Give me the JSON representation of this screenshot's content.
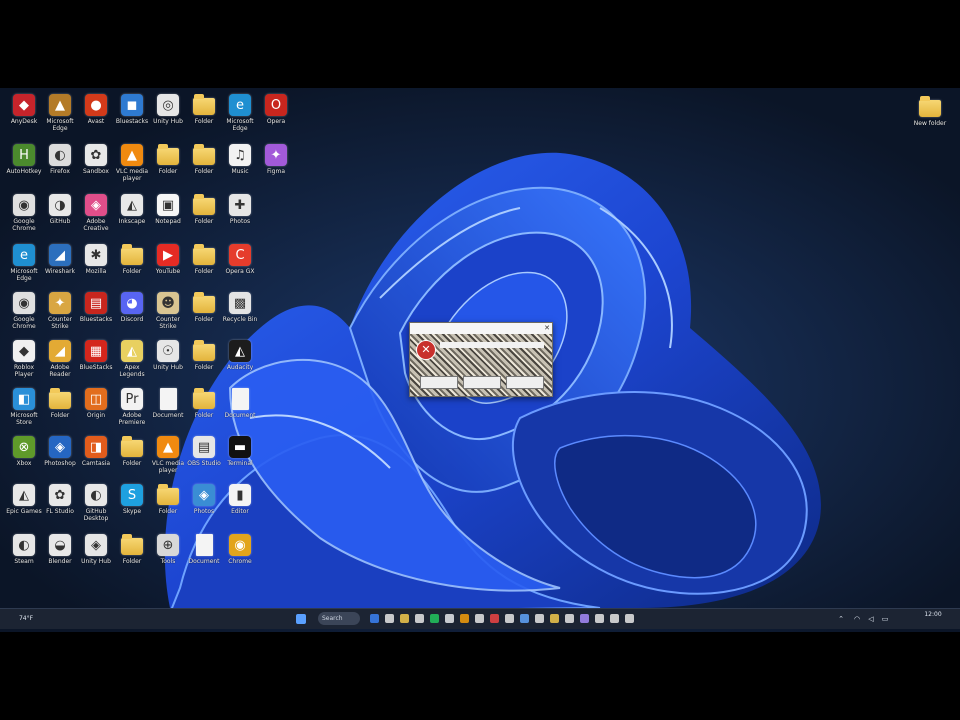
{
  "desktop": {
    "icons": [
      {
        "label": "AnyDesk",
        "glyph": "app",
        "color": "#c6242b",
        "sym": "◆"
      },
      {
        "label": "Microsoft Edge",
        "glyph": "app",
        "color": "#b47b28",
        "sym": "▲"
      },
      {
        "label": "Avast",
        "glyph": "app",
        "color": "#d33a1a",
        "sym": "●"
      },
      {
        "label": "Bluestacks",
        "glyph": "app",
        "color": "#2e7ad1",
        "sym": "◼"
      },
      {
        "label": "Unity Hub",
        "glyph": "app",
        "color": "#e6e6e6",
        "sym": "◎"
      },
      {
        "label": "Folder",
        "glyph": "folder"
      },
      {
        "label": "Microsoft Edge",
        "glyph": "app",
        "color": "#1f8fd1",
        "sym": "e"
      },
      {
        "label": "Opera",
        "glyph": "app",
        "color": "#c8261e",
        "sym": "O"
      },
      {
        "label": "AutoHotkey",
        "glyph": "app",
        "color": "#4b8a2d",
        "sym": "H"
      },
      {
        "label": "Firefox",
        "glyph": "app",
        "color": "#dcdcdc",
        "sym": "◐"
      },
      {
        "label": "Sandbox",
        "glyph": "app",
        "color": "#e8e8e8",
        "sym": "✿"
      },
      {
        "label": "VLC media player",
        "glyph": "app",
        "color": "#f08a10",
        "sym": "▲"
      },
      {
        "label": "Folder",
        "glyph": "folder"
      },
      {
        "label": "Folder",
        "glyph": "folder"
      },
      {
        "label": "Music",
        "glyph": "app",
        "color": "#f2f2f2",
        "sym": "♫"
      },
      {
        "label": "Figma",
        "glyph": "app",
        "color": "#a25ad9",
        "sym": "✦"
      },
      {
        "label": "Google Chrome",
        "glyph": "app",
        "color": "#e0e0e0",
        "sym": "◉"
      },
      {
        "label": "GitHub",
        "glyph": "app",
        "color": "#e8e8e8",
        "sym": "◑"
      },
      {
        "label": "Adobe Creative",
        "glyph": "app",
        "color": "#e04e8a",
        "sym": "◈"
      },
      {
        "label": "Inkscape",
        "glyph": "app",
        "color": "#e8e8e8",
        "sym": "◭"
      },
      {
        "label": "Notepad",
        "glyph": "app",
        "color": "#f6f6f6",
        "sym": "▣"
      },
      {
        "label": "Folder",
        "glyph": "folder"
      },
      {
        "label": "Photos",
        "glyph": "app",
        "color": "#e6e6e6",
        "sym": "✚"
      },
      {
        "label": "Microsoft Edge",
        "glyph": "app",
        "color": "#1f8fd1",
        "sym": "e"
      },
      {
        "label": "Wireshark",
        "glyph": "app",
        "color": "#2c6fbd",
        "sym": "◢"
      },
      {
        "label": "Mozilla",
        "glyph": "app",
        "color": "#e7e7e7",
        "sym": "✱"
      },
      {
        "label": "Folder",
        "glyph": "folder"
      },
      {
        "label": "YouTube",
        "glyph": "app",
        "color": "#e52b24",
        "sym": "▶"
      },
      {
        "label": "Folder",
        "glyph": "folder"
      },
      {
        "label": "Opera GX",
        "glyph": "app",
        "color": "#e53c2c",
        "sym": "C"
      },
      {
        "label": "Google Chrome",
        "glyph": "app",
        "color": "#e0e0e0",
        "sym": "◉"
      },
      {
        "label": "Counter Strike",
        "glyph": "app",
        "color": "#d9a642",
        "sym": "✦"
      },
      {
        "label": "Bluestacks",
        "glyph": "app",
        "color": "#c8261e",
        "sym": "▤"
      },
      {
        "label": "Discord",
        "glyph": "app",
        "color": "#5865f2",
        "sym": "◕"
      },
      {
        "label": "Counter Strike",
        "glyph": "app",
        "color": "#d9c592",
        "sym": "☻"
      },
      {
        "label": "Folder",
        "glyph": "folder"
      },
      {
        "label": "Recycle Bin",
        "glyph": "app",
        "color": "#e4e4e4",
        "sym": "▩"
      },
      {
        "label": "Roblox Player",
        "glyph": "app",
        "color": "#f0f0f0",
        "sym": "◆"
      },
      {
        "label": "Adobe Reader",
        "glyph": "app",
        "color": "#e3aa34",
        "sym": "◢"
      },
      {
        "label": "BlueStacks",
        "glyph": "app",
        "color": "#d4261c",
        "sym": "▦"
      },
      {
        "label": "Apex Legends",
        "glyph": "app",
        "color": "#e8d060",
        "sym": "◭"
      },
      {
        "label": "Unity Hub",
        "glyph": "app",
        "color": "#e6e6e6",
        "sym": "☉"
      },
      {
        "label": "Folder",
        "glyph": "folder"
      },
      {
        "label": "Audacity",
        "glyph": "app",
        "color": "#1c1c1c",
        "sym": "◭"
      },
      {
        "label": "Microsoft Store",
        "glyph": "app",
        "color": "#2a8fd8",
        "sym": "◧"
      },
      {
        "label": "Folder",
        "glyph": "folder"
      },
      {
        "label": "Origin",
        "glyph": "app",
        "color": "#e26d1d",
        "sym": "◫"
      },
      {
        "label": "Adobe Premiere",
        "glyph": "app",
        "color": "#f2f2f2",
        "sym": "Pr"
      },
      {
        "label": "Document",
        "glyph": "doc"
      },
      {
        "label": "Folder",
        "glyph": "folder"
      },
      {
        "label": "Document",
        "glyph": "doc"
      },
      {
        "label": "Xbox",
        "glyph": "app",
        "color": "#5f9a2a",
        "sym": "⊗"
      },
      {
        "label": "Photoshop",
        "glyph": "app",
        "color": "#2566c2",
        "sym": "◈"
      },
      {
        "label": "Camtasia",
        "glyph": "app",
        "color": "#e25c1c",
        "sym": "◨"
      },
      {
        "label": "Folder",
        "glyph": "folder"
      },
      {
        "label": "VLC media player",
        "glyph": "app",
        "color": "#f08a10",
        "sym": "▲"
      },
      {
        "label": "OBS Studio",
        "glyph": "app",
        "color": "#e6e6e6",
        "sym": "▤"
      },
      {
        "label": "Terminal",
        "glyph": "app",
        "color": "#111",
        "sym": "▬"
      },
      {
        "label": "Epic Games",
        "glyph": "app",
        "color": "#e8e8e8",
        "sym": "◭"
      },
      {
        "label": "FL Studio",
        "glyph": "app",
        "color": "#e8e8e8",
        "sym": "✿"
      },
      {
        "label": "GitHub Desktop",
        "glyph": "app",
        "color": "#e8e8e8",
        "sym": "◐"
      },
      {
        "label": "Skype",
        "glyph": "app",
        "color": "#1ea0e0",
        "sym": "S"
      },
      {
        "label": "Folder",
        "glyph": "folder"
      },
      {
        "label": "Photos",
        "glyph": "app",
        "color": "#3a8dd4",
        "sym": "◈"
      },
      {
        "label": "Editor",
        "glyph": "app",
        "color": "#f4f4f4",
        "sym": "▮"
      },
      {
        "label": "Steam",
        "glyph": "app",
        "color": "#e6e6e6",
        "sym": "◐"
      },
      {
        "label": "Blender",
        "glyph": "app",
        "color": "#e8e8e8",
        "sym": "◒"
      },
      {
        "label": "Unity Hub",
        "glyph": "app",
        "color": "#e6e6e6",
        "sym": "◈"
      },
      {
        "label": "Folder",
        "glyph": "folder"
      },
      {
        "label": "Tools",
        "glyph": "app",
        "color": "#d8d8d8",
        "sym": "⊕"
      },
      {
        "label": "Document",
        "glyph": "doc"
      },
      {
        "label": "Chrome",
        "glyph": "app",
        "color": "#e2a41c",
        "sym": "◉"
      }
    ],
    "right_folder": {
      "label": "New folder",
      "glyph": "folder"
    }
  },
  "dialog": {
    "title": "",
    "message": "",
    "buttons": [
      "",
      "",
      ""
    ],
    "error_symbol": "✕"
  },
  "taskbar": {
    "left_widget": "74°F",
    "search_label": "Search",
    "tray_time": "12:00",
    "tray_date": ""
  },
  "colors": {
    "screen_bg": "#0f1d33",
    "bloom_blue": "#1f55e6",
    "taskbar_bg": "#1c2433"
  }
}
